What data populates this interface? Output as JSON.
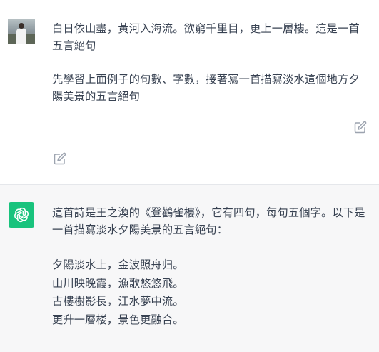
{
  "user_message": {
    "paragraph_1": "白日依山盡，黃河入海流。欲窮千里目，更上一層樓。這是一首五言絕句",
    "paragraph_2": "先學習上面例子的句數、字數，接著寫一首描寫淡水這個地方夕陽美景的五言絕句",
    "avatar_icon": "user-photo-avatar",
    "edit_icon": "pencil-square-icon"
  },
  "assistant_message": {
    "paragraph_1": "這首詩是王之渙的《登鸛雀樓》，它有四句，每句五個字。以下是一首描寫淡水夕陽美景的五言絕句：",
    "poem_lines": [
      "夕陽淡水上，金波照舟归。",
      "山川映晚霞，漁歌悠悠飛。",
      "古樓樹影長，江水夢中流。",
      "更升一層楼，景色更融合。"
    ],
    "avatar_icon": "openai-logo-icon",
    "avatar_color": "#19c37d"
  },
  "colors": {
    "user_bg": "#ffffff",
    "assistant_bg": "#f7f7f8",
    "text": "#374151",
    "icon": "#9ca3af"
  }
}
